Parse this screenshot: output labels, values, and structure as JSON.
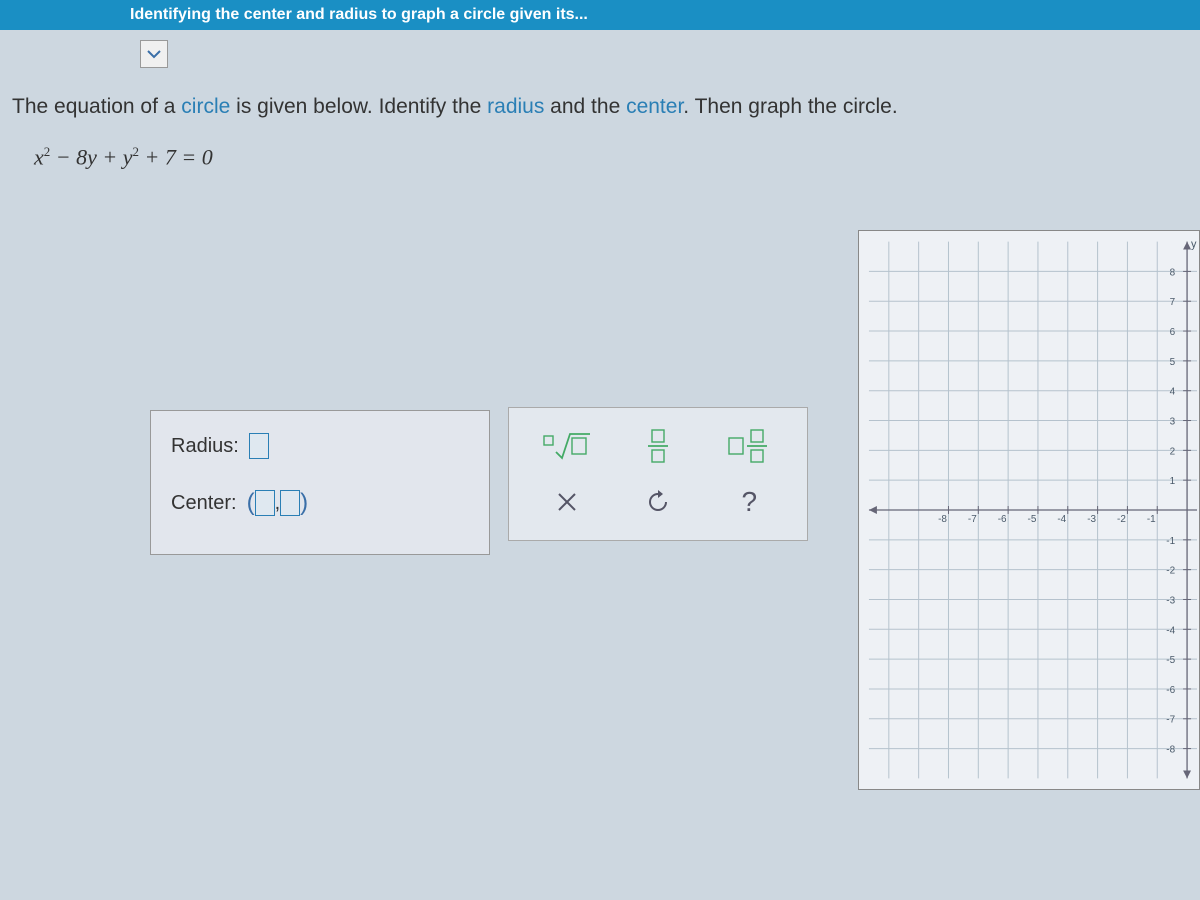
{
  "header": {
    "title": "Identifying the center and radius to graph a circle given its..."
  },
  "question": {
    "prefix": "The equation of a ",
    "link1": "circle",
    "mid1": " is given below. Identify the ",
    "link2": "radius",
    "mid2": " and the ",
    "link3": "center",
    "suffix": ". Then graph the circle."
  },
  "equation": {
    "display_parts": [
      "x",
      "2",
      " − 8y + y",
      "2",
      " + 7 = 0"
    ]
  },
  "answers": {
    "radius_label": "Radius:",
    "center_label": "Center:",
    "comma": ", "
  },
  "toolbox": {
    "root_label": "root",
    "fraction_label": "fraction",
    "mixed_label": "mixed-number",
    "clear_label": "×",
    "undo_label": "undo",
    "help_label": "?"
  },
  "graph": {
    "y_label": "y",
    "x_ticks_neg": [
      "-8",
      "-7",
      "-6",
      "-5",
      "-4",
      "-3",
      "-2",
      "-1"
    ],
    "y_ticks_pos": [
      "8",
      "7",
      "6",
      "5",
      "4",
      "3",
      "2",
      "1"
    ],
    "y_ticks_neg": [
      "-1",
      "-2",
      "-3",
      "-4",
      "-5",
      "-6",
      "-7",
      "-8"
    ]
  }
}
